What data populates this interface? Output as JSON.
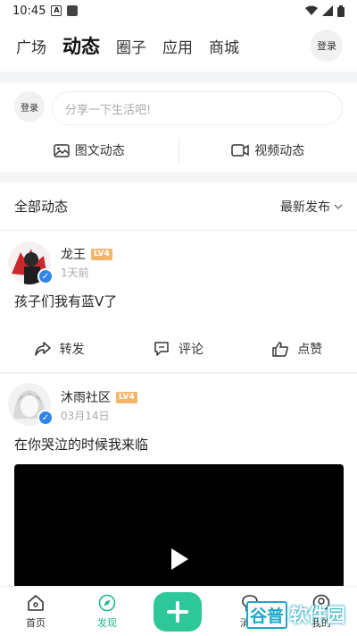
{
  "status_bar": {
    "time": "10:45"
  },
  "nav": {
    "tabs": [
      {
        "label": "广场"
      },
      {
        "label": "动态"
      },
      {
        "label": "圈子"
      },
      {
        "label": "应用"
      },
      {
        "label": "商城"
      }
    ],
    "active_tab": "动态",
    "login_label": "登录"
  },
  "composer": {
    "avatar_label": "登录",
    "placeholder": "分享一下生活吧!",
    "image_post_label": "图文动态",
    "video_post_label": "视频动态"
  },
  "filter": {
    "title": "全部动态",
    "sort_label": "最新发布"
  },
  "posts": [
    {
      "author": "龙王",
      "level": "LV4",
      "time": "1天前",
      "text": "孩子们我有蓝V了",
      "actions": {
        "repost": "转发",
        "comment": "评论",
        "like": "点赞"
      }
    },
    {
      "author": "沐雨社区",
      "level": "LV4",
      "time": "03月14日",
      "text": "在你哭泣的时候我来临"
    }
  ],
  "bottom_nav": {
    "items": [
      {
        "label": "首页"
      },
      {
        "label": "发现"
      },
      {
        "label": "消息"
      },
      {
        "label": "我的"
      }
    ],
    "active": "发现"
  },
  "watermark": {
    "text_box": "谷普",
    "text_rest": "软件园"
  },
  "colors": {
    "accent": "#2dc79a",
    "verified": "#2f86e8",
    "level_badge": "#f4b46b"
  }
}
